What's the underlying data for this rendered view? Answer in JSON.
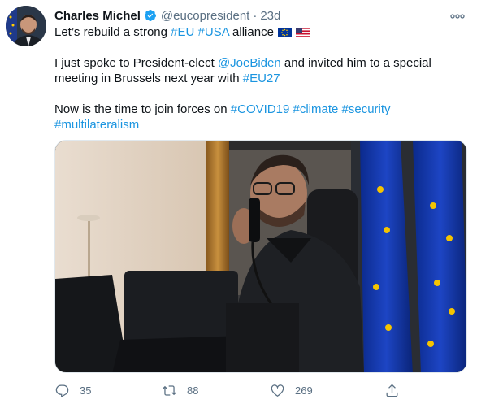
{
  "user": {
    "name": "Charles Michel",
    "handle": "@eucopresident",
    "separator": "·",
    "time": "23d"
  },
  "tweet": {
    "line1_text": "Let’s rebuild a strong ",
    "line1_tag1": "#EU",
    "line1_tag2": "#USA",
    "line1_tail": " alliance",
    "line2_pre": "I just spoke to President-elect ",
    "line2_mention": "@JoeBiden",
    "line2_post": " and invited him to a special",
    "line3_pre": "meeting in Brussels next year with ",
    "line3_tag": "#EU27",
    "line4_pre": "Now is the time to join forces on ",
    "line4_tag1": "#COVID19",
    "line4_tag2": "#climate",
    "line4_tag3": "#security",
    "line5_tag": "#multilateralism",
    "flags": [
      "eu-flag-emoji",
      "us-flag-emoji"
    ]
  },
  "actions": {
    "replies": "35",
    "retweets": "88",
    "likes": "269"
  },
  "icons": [
    "verified-badge-icon",
    "more-icon",
    "reply-icon",
    "retweet-icon",
    "like-icon",
    "share-icon"
  ],
  "colors": {
    "link": "#1b95e0",
    "muted": "#5b7083",
    "verified": "#1da1f2",
    "eu_blue": "#003399",
    "eu_star": "#ffcc00"
  }
}
